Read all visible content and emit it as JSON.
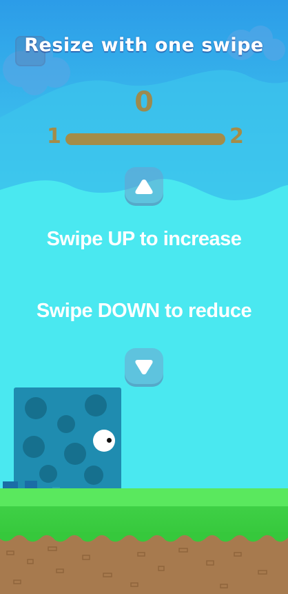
{
  "game": {
    "title": "Resize with one swipe",
    "level": {
      "current_score": "0",
      "start_level": "1",
      "next_level": "2",
      "progress": 0
    },
    "instructions": {
      "up": "Swipe UP to increase",
      "down": "Swipe DOWN to reduce"
    },
    "colors": {
      "sky_top": "#2c9ce8",
      "sky_bottom": "#4aeaf0",
      "player": "#1f8cb0",
      "grass": "#3fd046",
      "dirt": "#a77a4e",
      "progress": "#a48c48"
    }
  }
}
